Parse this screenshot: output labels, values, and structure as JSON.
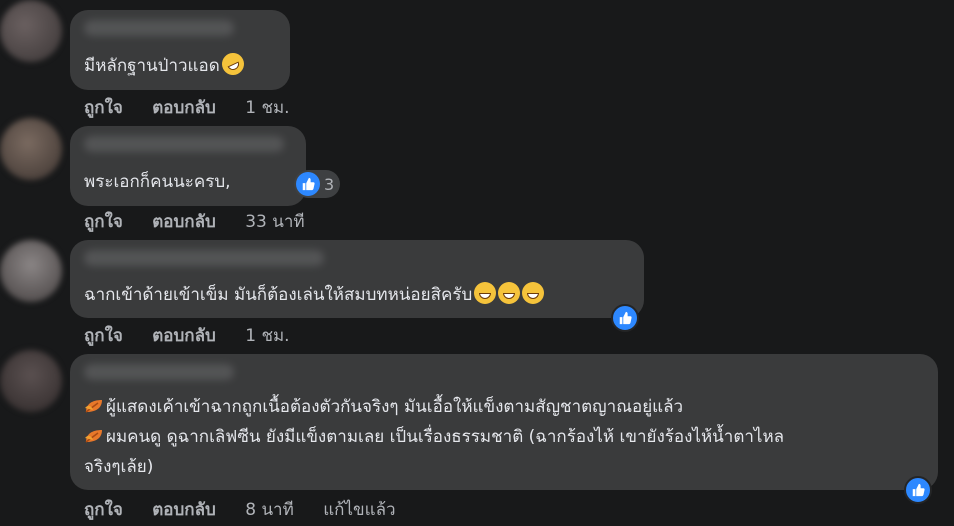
{
  "comments": [
    {
      "text": "มีหลักฐานป่าวแอด",
      "actions": {
        "like": "ถูกใจ",
        "reply": "ตอบกลับ",
        "time": "1 ชม."
      }
    },
    {
      "text": "พระเอกก็คนนะครบ,",
      "reaction_count": "3",
      "actions": {
        "like": "ถูกใจ",
        "reply": "ตอบกลับ",
        "time": "33 นาที"
      }
    },
    {
      "text": "ฉากเข้าด้ายเข้าเข็ม มันก็ต้องเล่นให้สมบทหน่อยสิครับ",
      "actions": {
        "like": "ถูกใจ",
        "reply": "ตอบกลับ",
        "time": "1 ชม."
      }
    },
    {
      "lines": [
        "ผู้แสดงเค้าเข้าฉากถูกเนื้อต้องตัวกันจริงๆ มันเอื้อให้แข็งตามสัญชาตญาณอยู่แล้ว",
        "ผมคนดู ดูฉากเลิฟซีน ยังมีแข็งตามเลย เป็นเรื่องธรรมชาติ (ฉากร้องไห้ เขายังร้องไห้น้ำตาไหล",
        "จริงๆเล้ย)"
      ],
      "actions": {
        "like": "ถูกใจ",
        "reply": "ตอบกลับ",
        "time": "8 นาที",
        "edited": "แก้ไขแล้ว"
      }
    }
  ],
  "icons": {
    "reaction": "like-thumb-icon",
    "emoji_laugh": "rolling-laughing-emoji-icon",
    "emoji_grin": "grinning-emoji-icon",
    "leaf": "autumn-leaf-icon"
  },
  "colors": {
    "background": "#18191a",
    "bubble": "#3a3b3c",
    "text": "#e4e6eb",
    "muted": "#b0b3b8",
    "like_blue": "#2d88ff"
  }
}
